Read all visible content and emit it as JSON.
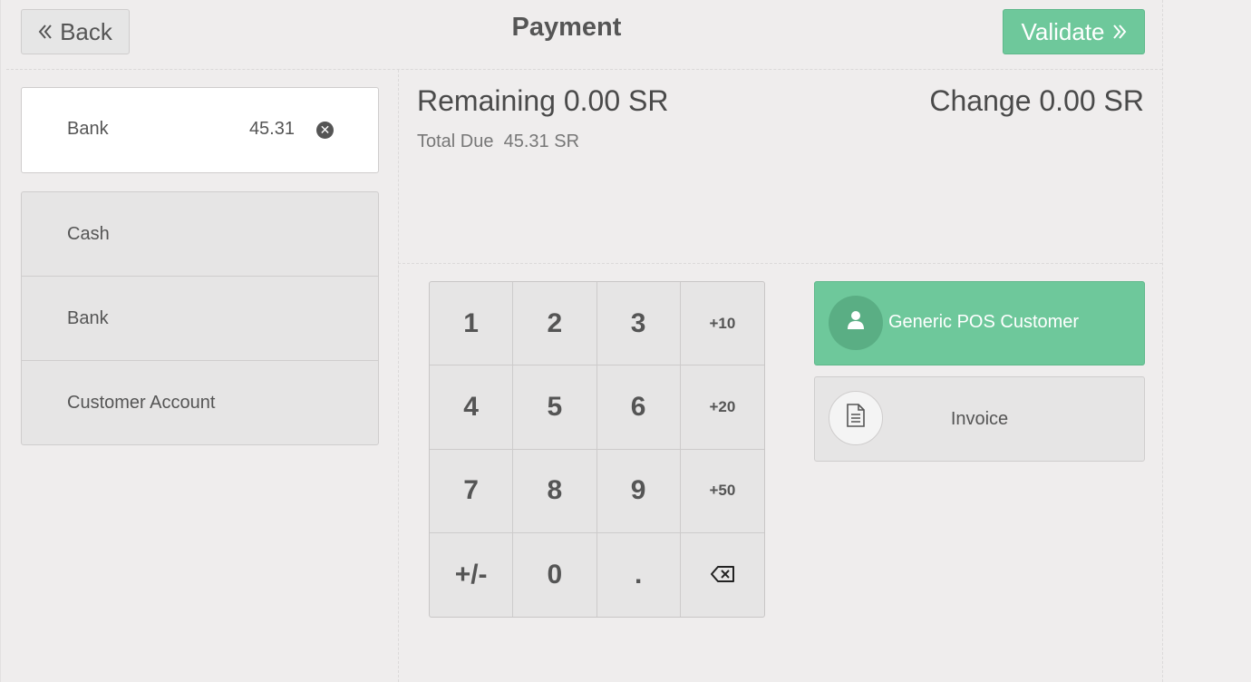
{
  "header": {
    "back_label": "Back",
    "title": "Payment",
    "validate_label": "Validate"
  },
  "paymentlines": [
    {
      "method": "Bank",
      "amount": "45.31"
    }
  ],
  "payment_methods": [
    "Cash",
    "Bank",
    "Customer Account"
  ],
  "summary": {
    "remaining_label": "Remaining",
    "remaining_value": "0.00 SR",
    "change_label": "Change",
    "change_value": "0.00 SR",
    "total_due_label": "Total Due",
    "total_due_value": "45.31 SR"
  },
  "numpad": {
    "keys": [
      "1",
      "2",
      "3",
      "+10",
      "4",
      "5",
      "6",
      "+20",
      "7",
      "8",
      "9",
      "+50",
      "+/-",
      "0",
      ".",
      "backspace-icon"
    ]
  },
  "customer": {
    "label": "Generic POS Customer"
  },
  "invoice": {
    "label": "Invoice"
  },
  "colors": {
    "accent_green": "#6ec89b",
    "background": "#efeded"
  }
}
